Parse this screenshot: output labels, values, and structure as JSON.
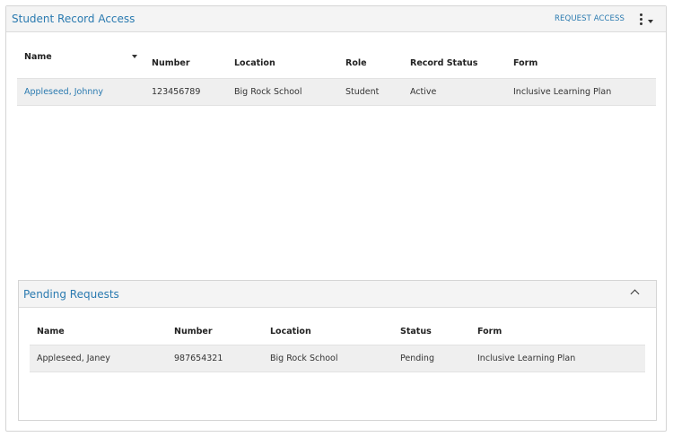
{
  "panel": {
    "title": "Student Record Access",
    "request_access_label": "REQUEST ACCESS",
    "menu_icon": "kebab-menu-icon"
  },
  "records": {
    "columns": [
      "Name",
      "Number",
      "Location",
      "Role",
      "Record Status",
      "Form"
    ],
    "rows": [
      {
        "name": "Appleseed, Johnny",
        "number": "123456789",
        "location": "Big Rock School",
        "role": "Student",
        "status": "Active",
        "form": "Inclusive Learning Plan"
      }
    ]
  },
  "pending": {
    "title": "Pending Requests",
    "columns": [
      "Name",
      "Number",
      "Location",
      "Status",
      "Form"
    ],
    "rows": [
      {
        "name": "Appleseed, Janey",
        "number": "987654321",
        "location": "Big Rock School",
        "status": "Pending",
        "form": "Inclusive Learning Plan"
      }
    ]
  },
  "colors": {
    "accent": "#2a7ab0",
    "row_bg": "#efefef",
    "header_bg": "#f4f4f4"
  }
}
